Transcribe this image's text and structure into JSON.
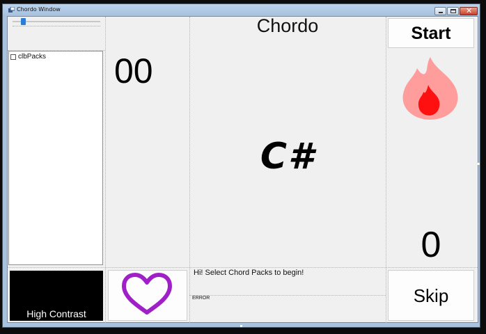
{
  "window": {
    "title": "Chordo Window"
  },
  "volume_slider": {
    "level_fraction": 0.1
  },
  "chord_packs": {
    "items": [
      {
        "label": "clbPacks",
        "checked": false
      }
    ]
  },
  "score": {
    "value": "00"
  },
  "app": {
    "title": "Chordo"
  },
  "current_chord": {
    "name": "C#"
  },
  "buttons": {
    "start": "Start",
    "skip": "Skip",
    "high_contrast": "High Contrast"
  },
  "streak": {
    "value": "0"
  },
  "status": {
    "message": "Hi! Select Chord Packs to begin!",
    "error": "ERROR"
  },
  "icons": {
    "flame": "flame-icon",
    "heart": "heart-icon",
    "app": "app-icon"
  },
  "colors": {
    "flame_outer": "#ff9c9c",
    "flame_inner": "#ff1010",
    "heart": "#a020c8",
    "high_contrast_bg": "#000000"
  }
}
